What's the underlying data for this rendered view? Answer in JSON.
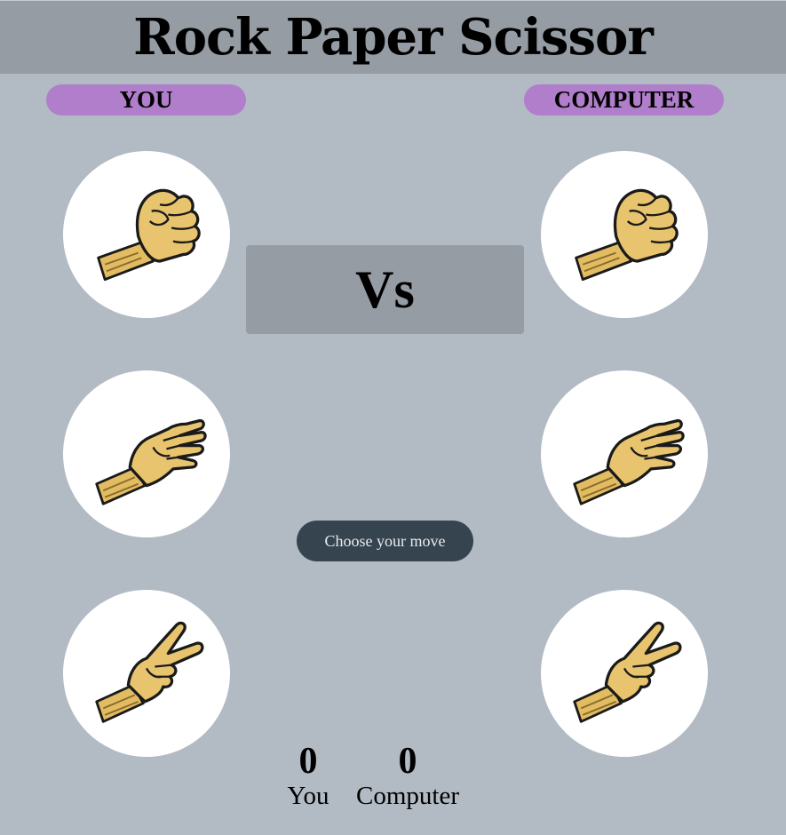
{
  "header": {
    "title": "Rock Paper Scissor"
  },
  "players": {
    "you_label": "YOU",
    "computer_label": "COMPUTER"
  },
  "choices": [
    {
      "name": "rock",
      "icon": "rock-fist-icon"
    },
    {
      "name": "paper",
      "icon": "paper-hand-icon"
    },
    {
      "name": "scissor",
      "icon": "scissor-hand-icon"
    }
  ],
  "versus": {
    "label": "Vs"
  },
  "status": {
    "message": "Choose your move"
  },
  "score": {
    "you_value": "0",
    "you_label": "You",
    "computer_value": "0",
    "computer_label": "Computer"
  },
  "colors": {
    "background": "#b2bac4",
    "header": "#959ca4",
    "pill": "#b07ecb",
    "message_bg": "#36444f",
    "skin": "#e8c46e"
  }
}
